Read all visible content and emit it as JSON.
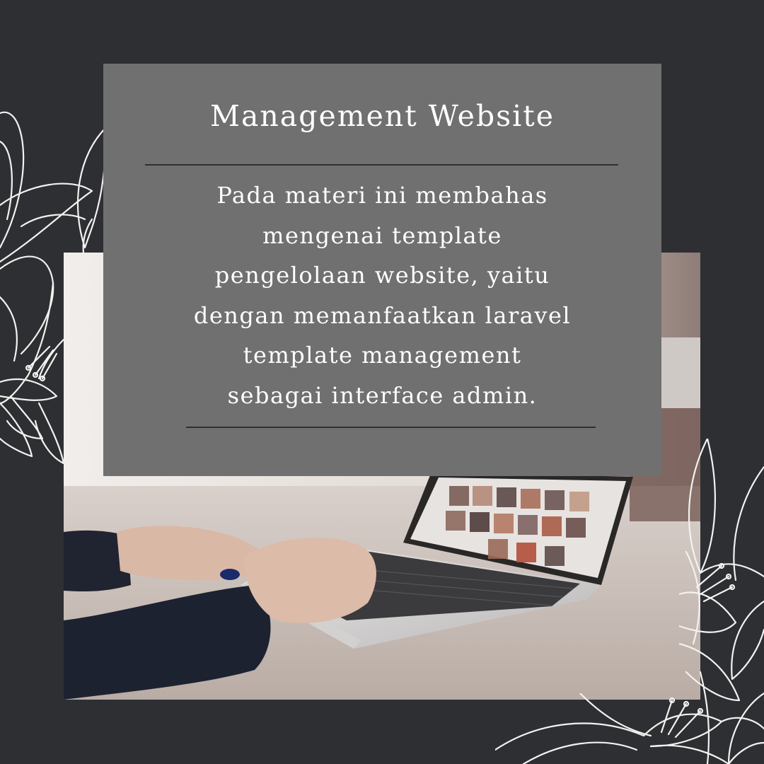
{
  "card": {
    "title": "Management Website",
    "body_lines": [
      "Pada materi ini membahas",
      "mengenai template",
      "pengelolaan website, yaitu",
      "dengan memanfaatkan laravel",
      "template management",
      "sebagai interface admin."
    ]
  },
  "colors": {
    "background": "#2d2f33",
    "card": "#707070",
    "rule": "#2f3033",
    "text": "#ffffff",
    "floral_stroke": "#f2f2ef"
  },
  "decor": {
    "photo": "laptop-typing-photo",
    "floral_left": "lily-lineart-icon",
    "floral_right": "lily-lineart-icon",
    "floral_bottom": "lily-lineart-icon"
  }
}
